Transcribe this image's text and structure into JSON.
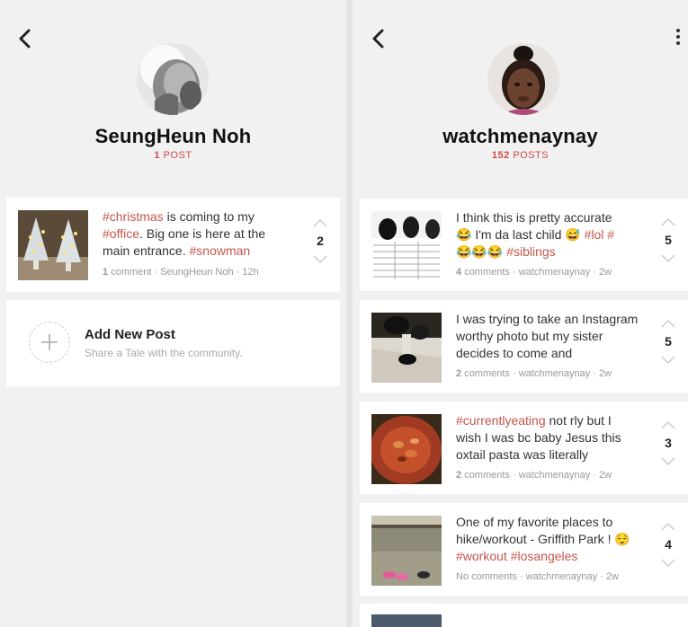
{
  "left_profile": {
    "name": "SeungHeun Noh",
    "post_count": "1",
    "post_count_label": "POST",
    "posts": [
      {
        "segments": [
          {
            "text": "#christmas",
            "tag": true
          },
          {
            "text": " is coming to my ",
            "tag": false
          },
          {
            "text": "#office",
            "tag": true
          },
          {
            "text": ". Big one is here at the main entrance. ",
            "tag": false
          },
          {
            "text": "#snowman",
            "tag": true
          }
        ],
        "comment_count": "1",
        "comment_label": "comment",
        "author": "SeungHeun Noh",
        "time": "12h",
        "score": "2"
      }
    ],
    "add_post": {
      "title": "Add New Post",
      "subtitle": "Share a Tale with the community."
    }
  },
  "right_profile": {
    "name": "watchmenaynay",
    "post_count": "152",
    "post_count_label": "POSTS",
    "posts": [
      {
        "segments": [
          {
            "text": "I think this is pretty accurate 😂 I'm da last child 😅 ",
            "tag": false
          },
          {
            "text": "#lol",
            "tag": true
          },
          {
            "text": " ",
            "tag": false
          },
          {
            "text": "#",
            "tag": true
          },
          {
            "text": "😂😂😂 ",
            "tag": false
          },
          {
            "text": "#siblings",
            "tag": true
          }
        ],
        "comment_count": "4",
        "comment_label": "comments",
        "author": "watchmenaynay",
        "time": "2w",
        "score": "5"
      },
      {
        "segments": [
          {
            "text": "I was trying to take an Instagram worthy photo but my sister decides to come and",
            "tag": false
          }
        ],
        "comment_count": "2",
        "comment_label": "comments",
        "author": "watchmenaynay",
        "time": "2w",
        "score": "5"
      },
      {
        "segments": [
          {
            "text": "#currentlyeating",
            "tag": true
          },
          {
            "text": " not rly but I wish I was bc baby Jesus this oxtail pasta was literally",
            "tag": false
          }
        ],
        "comment_count": "2",
        "comment_label": "comments",
        "author": "watchmenaynay",
        "time": "2w",
        "score": "3"
      },
      {
        "segments": [
          {
            "text": "One of my favorite places to hike/workout - Griffith Park ! 😌 ",
            "tag": false
          },
          {
            "text": "#workout",
            "tag": true
          },
          {
            "text": " ",
            "tag": false
          },
          {
            "text": "#losangeles",
            "tag": true
          }
        ],
        "comment_count": "No",
        "comment_label": "comments",
        "author": "watchmenaynay",
        "time": "2w",
        "score": "4"
      }
    ]
  },
  "icons": {
    "back": "chevron-left-icon",
    "more": "more-vertical-icon",
    "upvote": "chevron-up-icon",
    "downvote": "chevron-down-icon",
    "add": "plus-icon"
  },
  "colors": {
    "hashtag": "#c4564a",
    "post_count": "#d14a4a",
    "background": "#f1f1f1",
    "card": "#ffffff"
  }
}
